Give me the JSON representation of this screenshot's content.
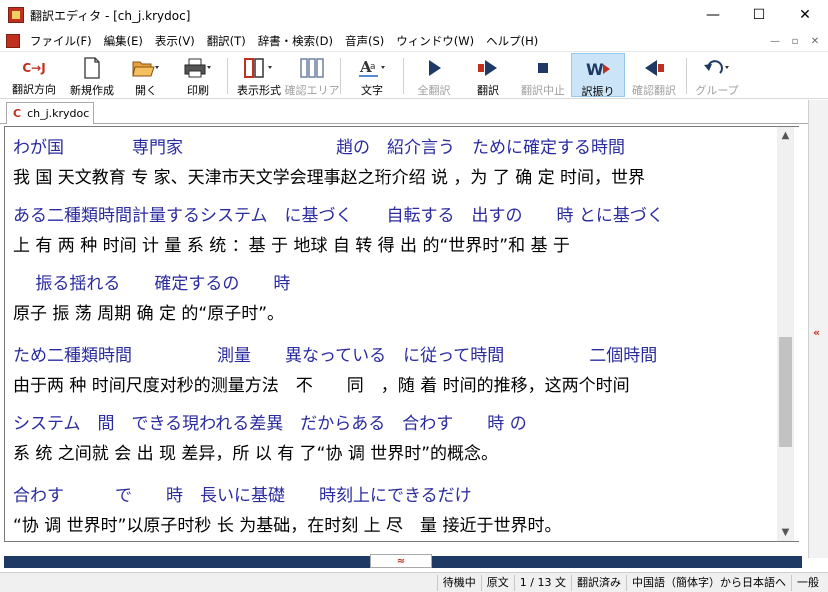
{
  "window": {
    "title": "翻訳エディタ - [ch_j.krydoc]",
    "minimize": "—",
    "maximize": "☐",
    "close": "✕"
  },
  "menu": {
    "items": [
      "ファイル(F)",
      "編集(E)",
      "表示(V)",
      "翻訳(T)",
      "辞書・検索(D)",
      "音声(S)",
      "ウィンドウ(W)",
      "ヘルプ(H)"
    ],
    "mdi_minimize": "—",
    "mdi_restore": "▫",
    "mdi_close": "✕"
  },
  "toolbar": {
    "direction": "翻訳方向",
    "direction_glyph": "C→J",
    "new": "新規作成",
    "open": "開く",
    "print": "印刷",
    "display": "表示形式",
    "confirm_area": "確認エリア",
    "text": "文字",
    "translate_all": "全翻訳",
    "translate": "翻訳",
    "stop": "翻訳中止",
    "translation_choice": "訳振り",
    "confirm_translation": "確認翻訳",
    "group": "グループ"
  },
  "tab": {
    "icon_letter": "C",
    "name": "ch_j.krydoc"
  },
  "editor": {
    "lines": [
      {
        "lang": "ja",
        "text": "わが国　　　　専門家　　　　　　　　　趙の　紹介言う　ために確定する時間"
      },
      {
        "lang": "zh",
        "text": "我 国 天文教育 专 家、天津市天文学会理事赵之珩介绍 说 ，为 了 确 定 时间，世界"
      },
      {
        "lang": "ja",
        "text": " ある二種類時間計量するシステム　に基づく　　自転する　出すの　　時 とに基づく"
      },
      {
        "lang": "zh",
        "text": "上 有 两 种 时间 计 量 系 统 ：基 于 地球 自 转 得 出 的“世界时”和 基 于"
      },
      {
        "lang": "ja",
        "text": "　 振る揺れる　　確定するの　　時"
      },
      {
        "lang": "zh",
        "text": "原子 振 荡 周期 确 定 的“原子时”。"
      },
      {
        "lang": "ja",
        "text": "ため二種類時間　　　　　測量　　異なっている　に従って時間　　　　　二個時間"
      },
      {
        "lang": "zh",
        "text": "由于两 种 时间尺度对秒的测量方法　不　　同　，随 着 时间的推移，这两个时间"
      },
      {
        "lang": "ja",
        "text": "システム　間　できる現われる差異　だからある　合わす　　時 の"
      },
      {
        "lang": "zh",
        "text": " 系 统 之间就 会 出 现 差异，所 以 有 了“协 调 世界时”的概念。"
      },
      {
        "lang": "ja",
        "text": " 合わす　　　で　　時　長いに基礎　　時刻上にできるだけ"
      },
      {
        "lang": "zh",
        "text": "“协 调 世界时”以原子时秒 长 为基础，在时刻 上 尽　量 接近于世界时。"
      }
    ]
  },
  "splitter": {
    "bottom_grip": "≈",
    "right_grip": "«"
  },
  "statusbar": {
    "state": "待機中",
    "mode": "原文",
    "position": "1 / 13 文",
    "translated": "翻訳済み",
    "direction": "中国語（簡体字）から日本語へ",
    "field": "一般"
  },
  "colors": {
    "japanese_text": "#2b2ba0",
    "chinese_text": "#000000",
    "splitter_bar": "#1e3a64",
    "accent": "#c03020"
  }
}
